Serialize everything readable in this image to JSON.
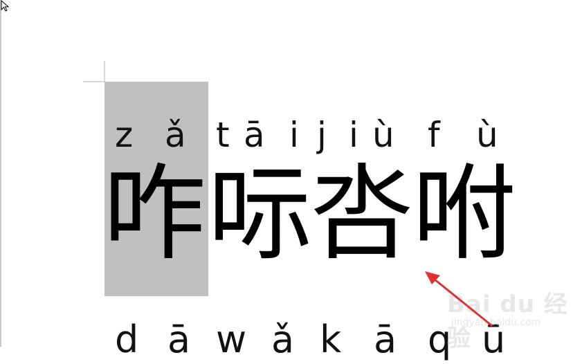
{
  "pinyin_top": [
    "z",
    "ǎ",
    "t",
    "ā",
    "i",
    "j",
    "i",
    "ù",
    "f",
    "ù"
  ],
  "hanzi": [
    "咋",
    "呩",
    "呇",
    "咐"
  ],
  "pinyin_bottom": [
    "d",
    "ā",
    "w",
    "ǎ",
    "k",
    "ā",
    "q",
    "ū"
  ],
  "watermark": {
    "brand": "Bai du 经验",
    "sub": "jingyan.baidu.com"
  },
  "colors": {
    "selection": "#c0c0c0",
    "arrow": "#e03030",
    "text": "#000000"
  }
}
